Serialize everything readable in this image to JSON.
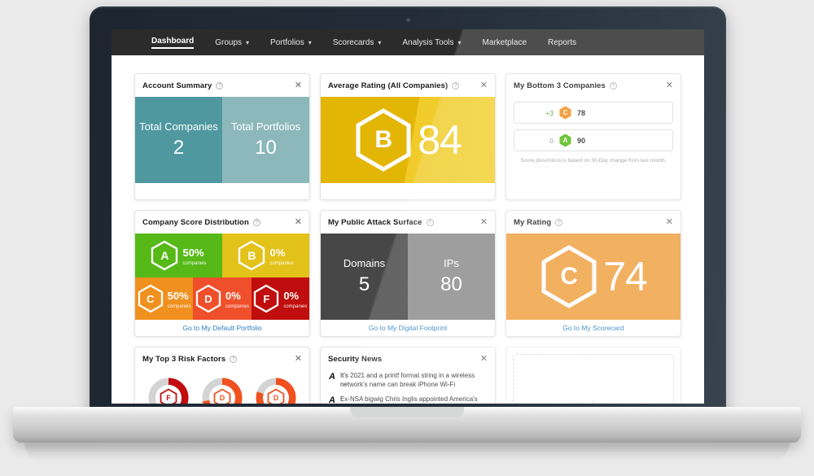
{
  "nav": {
    "items": [
      {
        "label": "Dashboard",
        "caret": false,
        "active": true
      },
      {
        "label": "Groups",
        "caret": true,
        "active": false
      },
      {
        "label": "Portfolios",
        "caret": true,
        "active": false
      },
      {
        "label": "Scorecards",
        "caret": true,
        "active": false
      },
      {
        "label": "Analysis Tools",
        "caret": true,
        "active": false
      },
      {
        "label": "Marketplace",
        "caret": false,
        "active": false
      },
      {
        "label": "Reports",
        "caret": false,
        "active": false
      }
    ],
    "caret_glyph": "▾"
  },
  "icons": {
    "help": "?",
    "close": "✕",
    "plus": "+",
    "news_logo": "A"
  },
  "cards": {
    "account_summary": {
      "title": "Account Summary",
      "tiles": [
        {
          "label": "Total Companies",
          "value": "2",
          "color": "#4f98a0"
        },
        {
          "label": "Total Portfolios",
          "value": "10",
          "color": "#8cb8bb"
        }
      ]
    },
    "average_rating": {
      "title": "Average Rating (All Companies)",
      "grade": "B",
      "score": "84",
      "color": "#e3b505"
    },
    "bottom3": {
      "title": "My Bottom 3 Companies",
      "rows": [
        {
          "delta": "+3",
          "grade": "C",
          "score": "78",
          "color": "#f0901e",
          "delta_kind": "up"
        },
        {
          "delta": "0",
          "grade": "A",
          "score": "90",
          "color": "#56b918",
          "delta_kind": "zero"
        }
      ],
      "note": "Score plus/minus is based on 30-Day change from last month."
    },
    "score_distribution": {
      "title": "Company Score Distribution",
      "unit": "companies",
      "cells": [
        {
          "grade": "A",
          "percent": "50%",
          "color": "#56b918"
        },
        {
          "grade": "B",
          "percent": "0%",
          "color": "#e3c21a"
        },
        {
          "grade": "C",
          "percent": "50%",
          "color": "#f0901e"
        },
        {
          "grade": "D",
          "percent": "0%",
          "color": "#f04f2b"
        },
        {
          "grade": "F",
          "percent": "0%",
          "color": "#c00d0d"
        }
      ],
      "link": "Go to My Default Portfolio"
    },
    "attack_surface": {
      "title": "My Public Attack Surface",
      "tiles": [
        {
          "label": "Domains",
          "value": "5",
          "color": "#474747"
        },
        {
          "label": "IPs",
          "value": "80",
          "color": "#8c8c8c"
        }
      ],
      "link": "Go to My Digital Footprint"
    },
    "my_rating": {
      "title": "My Rating",
      "grade": "C",
      "score": "74",
      "color": "#efa143",
      "link": "Go to My Scorecard"
    },
    "risk_factors": {
      "title": "My Top 3 Risk Factors",
      "gauges": [
        {
          "grade": "F",
          "percent": 62,
          "color": "#c00d0d",
          "track": "#d4d4d4"
        },
        {
          "grade": "D",
          "percent": 72,
          "color": "#f0511f",
          "track": "#d4d4d4"
        },
        {
          "grade": "D",
          "percent": 80,
          "color": "#f0511f",
          "track": "#d4d4d4"
        }
      ]
    },
    "security_news": {
      "title": "Security News",
      "items": [
        "It's 2021 and a printf format string in a wireless network's name can break iPhone Wi-Fi",
        "Ex-NSA bigwig Chris Inglis appointed America's national cyber director by Senate"
      ]
    },
    "add_widget": {
      "title": ""
    }
  }
}
